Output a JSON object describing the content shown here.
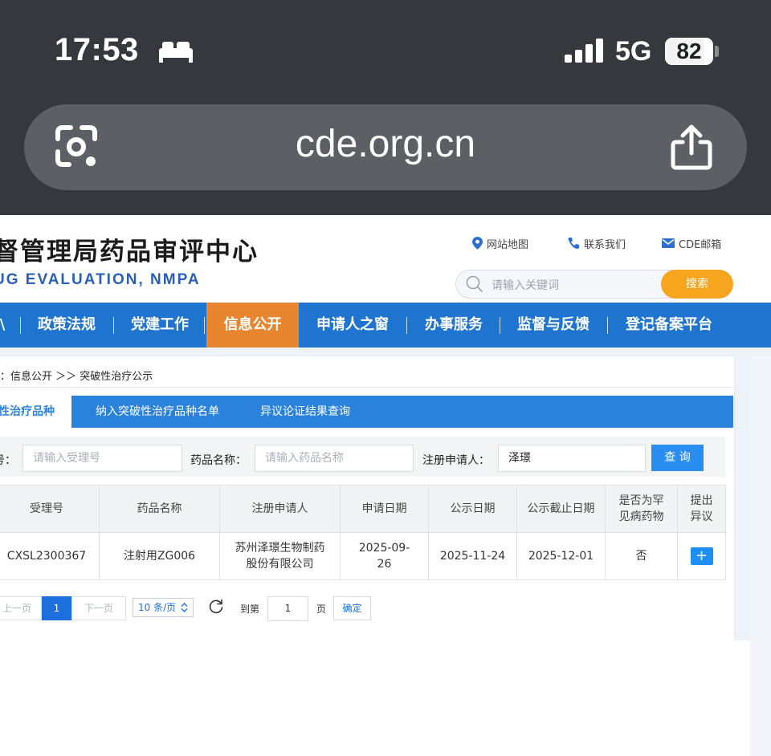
{
  "status_bar": {
    "time": "17:53",
    "network": "5G",
    "battery": "82",
    "battery_level": 0.82
  },
  "browser": {
    "url": "cde.org.cn"
  },
  "header": {
    "title": "督管理局药品审评中心",
    "subtitle": "UG EVALUATION, NMPA",
    "links": [
      {
        "label": "网站地图",
        "icon": "location-pin-icon"
      },
      {
        "label": "联系我们",
        "icon": "phone-icon"
      },
      {
        "label": "CDE邮箱",
        "icon": "mail-icon"
      }
    ],
    "search": {
      "placeholder": "请输入关键词",
      "button": "搜索"
    }
  },
  "nav": {
    "items": [
      "\\",
      "政策法规",
      "党建工作",
      "信息公开",
      "申请人之窗",
      "办事服务",
      "监督与反馈",
      "登记备案平台"
    ],
    "active": "信息公开"
  },
  "breadcrumb": "：信息公开 ＞＞ 突破性治疗公示",
  "tabs": [
    "性治疗品种",
    "纳入突破性治疗品种名单",
    "异议论证结果查询"
  ],
  "filters": {
    "accept_no_label": "号：",
    "accept_no_placeholder": "请输入受理号",
    "drug_name_label": "药品名称：",
    "drug_name_placeholder": "请输入药品名称",
    "applicant_label": "注册申请人：",
    "applicant_value": "泽璟",
    "query_button": "查 询"
  },
  "table": {
    "headers": [
      "受理号",
      "药品名称",
      "注册申请人",
      "申请日期",
      "公示日期",
      "公示截止日期",
      "是否为罕见病药物",
      "提出异议"
    ],
    "rows": [
      {
        "accept_no": "CXSL2300367",
        "drug_name": "注射用ZG006",
        "applicant": "苏州泽璟生物制药股份有限公司",
        "apply_date": "2025-09-26",
        "publish_date": "2025-11-24",
        "deadline": "2025-12-01",
        "rare_disease": "否",
        "objection": "+"
      }
    ]
  },
  "pager": {
    "prev": "上一页",
    "current": "1",
    "next": "下一页",
    "page_size": "10 条/页",
    "goto_label": "到第",
    "goto_value": "1",
    "page_unit": "页",
    "confirm": "确定"
  },
  "colors": {
    "nav_blue": "#1f74d0",
    "nav_active": "#e8852f",
    "search_button": "#f7a51e",
    "tab_blue": "#2a82dd"
  }
}
